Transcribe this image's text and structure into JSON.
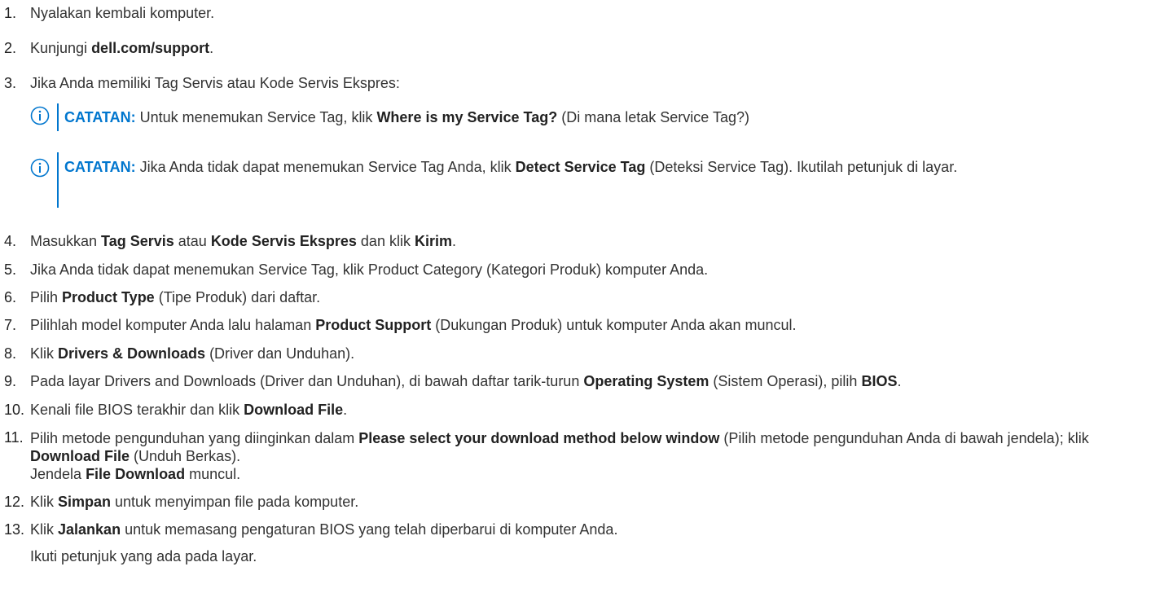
{
  "steps": {
    "s1": {
      "num": "1.",
      "text": "Nyalakan kembali komputer."
    },
    "s2": {
      "num": "2.",
      "pre": "Kunjungi ",
      "b1": "dell.com/support",
      "post": "."
    },
    "s3": {
      "num": "3.",
      "text": "Jika Anda memiliki Tag Servis atau Kode Servis Ekspres:"
    },
    "s4": {
      "num": "4.",
      "pre": "Masukkan ",
      "b1": "Tag Servis",
      "m1": " atau ",
      "b2": "Kode Servis Ekspres",
      "m2": " dan klik ",
      "b3": "Kirim",
      "post": "."
    },
    "s5": {
      "num": "5.",
      "text": "Jika Anda tidak dapat menemukan Service Tag, klik Product Category (Kategori Produk) komputer Anda."
    },
    "s6": {
      "num": "6.",
      "pre": "Pilih ",
      "b1": "Product Type",
      "post": " (Tipe Produk) dari daftar."
    },
    "s7": {
      "num": "7.",
      "pre": "Pilihlah model komputer Anda lalu halaman ",
      "b1": "Product Support",
      "post": " (Dukungan Produk) untuk komputer Anda akan muncul."
    },
    "s8": {
      "num": "8.",
      "pre": "Klik ",
      "b1": "Drivers & Downloads",
      "post": " (Driver dan Unduhan)."
    },
    "s9": {
      "num": "9.",
      "pre": "Pada layar Drivers and Downloads (Driver dan Unduhan), di bawah daftar tarik-turun ",
      "b1": "Operating System",
      "m1": " (Sistem Operasi), pilih ",
      "b2": "BIOS",
      "post": "."
    },
    "s10": {
      "num": "10.",
      "pre": "Kenali file BIOS terakhir dan klik ",
      "b1": "Download File",
      "post": "."
    },
    "s11": {
      "num": "11.",
      "pre": "Pilih metode pengunduhan yang diinginkan dalam ",
      "b1": "Please select your download method below window",
      "m1": " (Pilih metode pengunduhan Anda di bawah jendela); klik ",
      "b2": "Download File",
      "m2": " (Unduh Berkas).",
      "line2_pre": "Jendela ",
      "line2_b": "File Download",
      "line2_post": " muncul."
    },
    "s12": {
      "num": "12.",
      "pre": "Klik ",
      "b1": "Simpan",
      "post": " untuk menyimpan file pada komputer."
    },
    "s13": {
      "num": "13.",
      "pre": "Klik ",
      "b1": "Jalankan",
      "post": " untuk memasang pengaturan BIOS yang telah diperbarui di komputer Anda.",
      "line2": "Ikuti petunjuk yang ada pada layar."
    }
  },
  "notes": {
    "n1": {
      "label": "CATATAN:",
      "pre": " Untuk menemukan Service Tag, klik ",
      "b1": "Where is my Service Tag?",
      "post": " (Di mana letak Service Tag?)"
    },
    "n2": {
      "label": "CATATAN:",
      "pre": " Jika Anda tidak dapat menemukan Service Tag Anda, klik ",
      "b1": "Detect Service Tag",
      "post": " (Deteksi Service Tag). Ikutilah petunjuk di layar."
    }
  },
  "colors": {
    "note_accent": "#0076ce",
    "text": "#333333"
  },
  "icons": {
    "note": "info-circle-icon"
  }
}
